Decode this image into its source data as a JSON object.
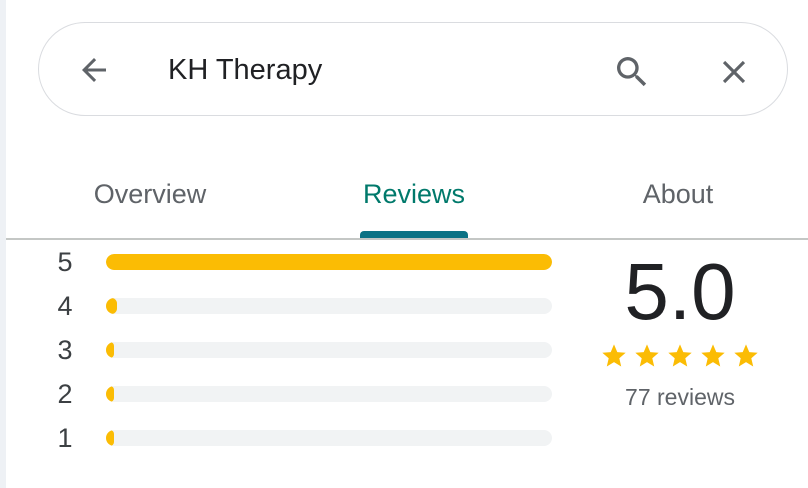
{
  "search": {
    "value": "KH Therapy"
  },
  "icons": {
    "back": "arrow-left-icon",
    "search": "magnifier-icon",
    "clear": "close-x-icon",
    "star": "star-icon"
  },
  "colors": {
    "accent_tab_text": "#00796b",
    "accent_tab_indicator": "#0b7285",
    "star": "#fbbc04",
    "bar_track": "#f1f3f4"
  },
  "tabs": [
    {
      "label": "Overview",
      "active": false
    },
    {
      "label": "Reviews",
      "active": true
    },
    {
      "label": "About",
      "active": false
    }
  ],
  "rating_histogram": [
    {
      "stars": "5",
      "fraction": 1.0
    },
    {
      "stars": "4",
      "fraction": 0.025
    },
    {
      "stars": "3",
      "fraction": 0.008
    },
    {
      "stars": "2",
      "fraction": 0.008
    },
    {
      "stars": "1",
      "fraction": 0.008
    }
  ],
  "summary": {
    "rating": "5.0",
    "star_count": 5,
    "reviews_text": "77 reviews"
  }
}
